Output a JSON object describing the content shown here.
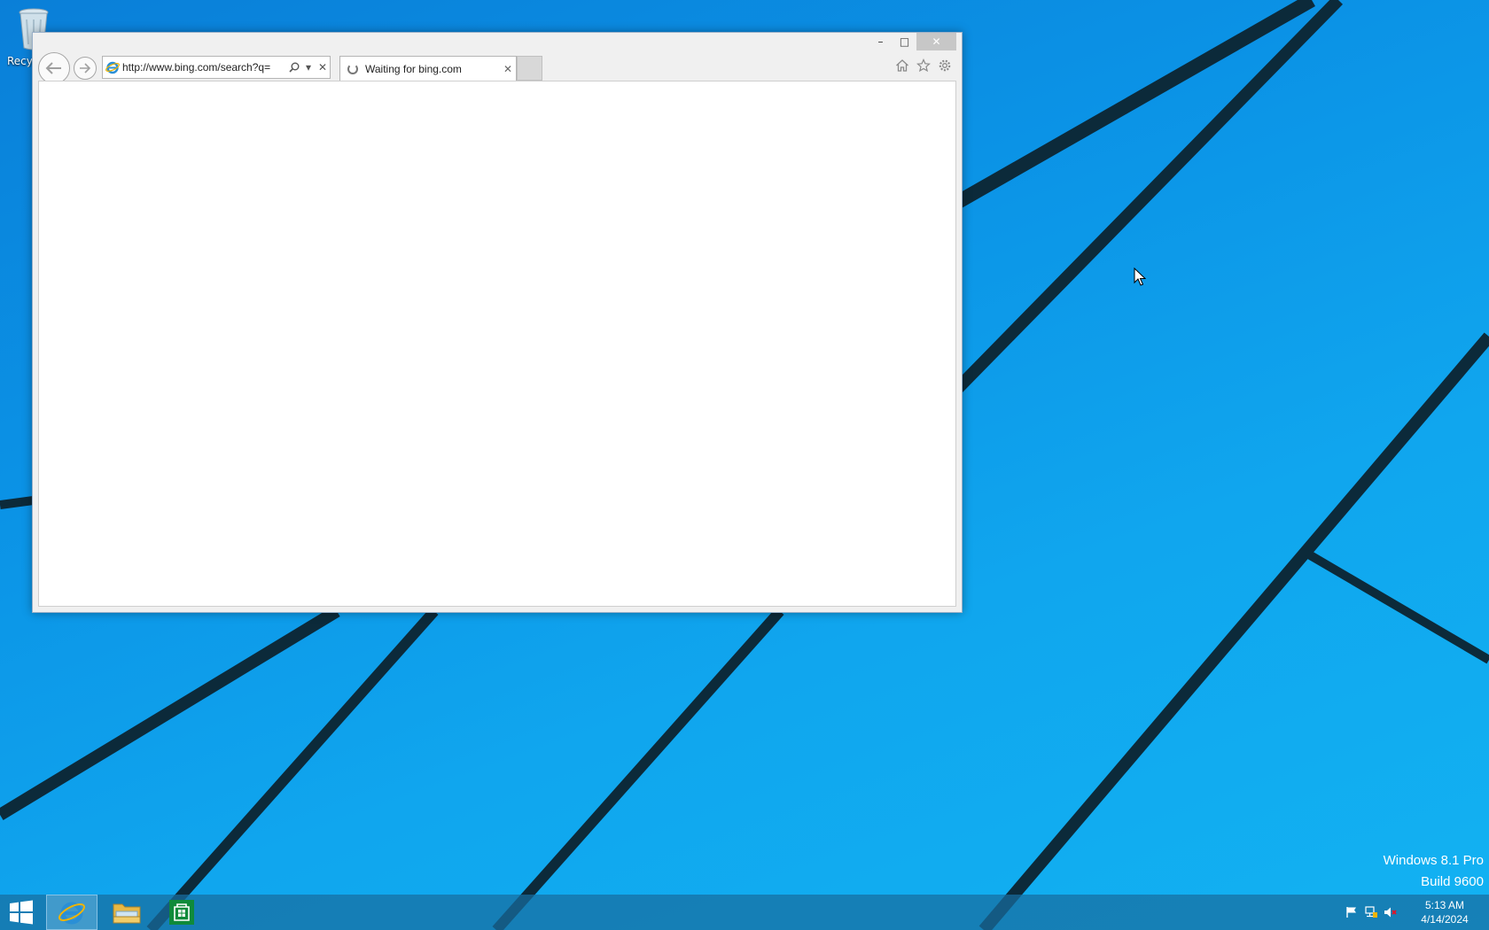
{
  "desktop": {
    "recycle_bin_label": "Recycle Bin",
    "watermark_line1": "Windows 8.1 Pro",
    "watermark_line2": "Build 9600"
  },
  "browser": {
    "address_value": "http://www.bing.com/search?q=",
    "tab_title": "Waiting for bing.com",
    "buttons": {
      "minimize": "–",
      "maximize": "□",
      "close": "✕",
      "tab_close": "✕",
      "address_stop": "✕",
      "address_dropdown": "▾"
    }
  },
  "taskbar": {
    "pinned": [
      "start-icon",
      "internet-explorer-icon",
      "file-explorer-icon",
      "windows-store-icon"
    ],
    "clock_time": "5:13 AM",
    "clock_date": "4/14/2024",
    "tray": [
      "action-center-flag-icon",
      "network-icon",
      "volume-muted-icon"
    ]
  },
  "colors": {
    "desktop_blue": "#0b93e6",
    "store_green": "#0f8a3a",
    "ie_blue": "#1e90d6"
  }
}
